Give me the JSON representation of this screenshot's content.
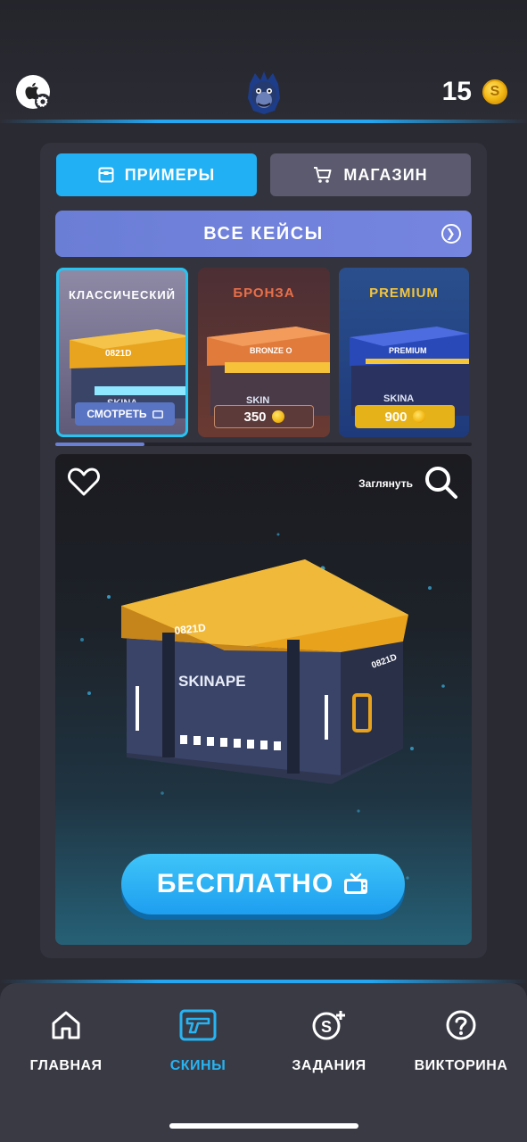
{
  "header": {
    "coins": "15",
    "coin_symbol": "S"
  },
  "tabs": [
    {
      "label": "ПРИМЕРЫ",
      "active": true
    },
    {
      "label": "МАГАЗИН",
      "active": false
    }
  ],
  "all_cases_label": "ВСЕ КЕЙСЫ",
  "cases": [
    {
      "title": "КЛАССИЧЕСКИЙ",
      "action": "СМОТРЕТЬ",
      "selected": true,
      "box_label": "0821D",
      "brand": "SKINA"
    },
    {
      "title": "БРОНЗА",
      "price": "350",
      "box_label": "BRONZE O",
      "brand": "SKIN"
    },
    {
      "title": "PREMIUM",
      "price": "900",
      "box_label": "PREMIUM",
      "brand": "SKINA"
    }
  ],
  "scene": {
    "peek_label": "Заглянуть",
    "box_code": "0821D",
    "box_code_side": "0821D",
    "box_brand": "SKINAPE",
    "free_button": "БЕСПЛАТНО"
  },
  "nav": [
    {
      "label": "ГЛАВНАЯ",
      "icon": "home-icon",
      "active": false
    },
    {
      "label": "СКИНЫ",
      "icon": "gun-icon",
      "active": true
    },
    {
      "label": "ЗАДАНИЯ",
      "icon": "tasks-coin-icon",
      "active": false
    },
    {
      "label": "ВИКТОРИНА",
      "icon": "question-icon",
      "active": false
    }
  ],
  "colors": {
    "accent": "#22b0f4",
    "panel": "#33333d",
    "background": "#2a2a33",
    "all_cases": "#6b7ed6",
    "gold": "#f3b814"
  }
}
